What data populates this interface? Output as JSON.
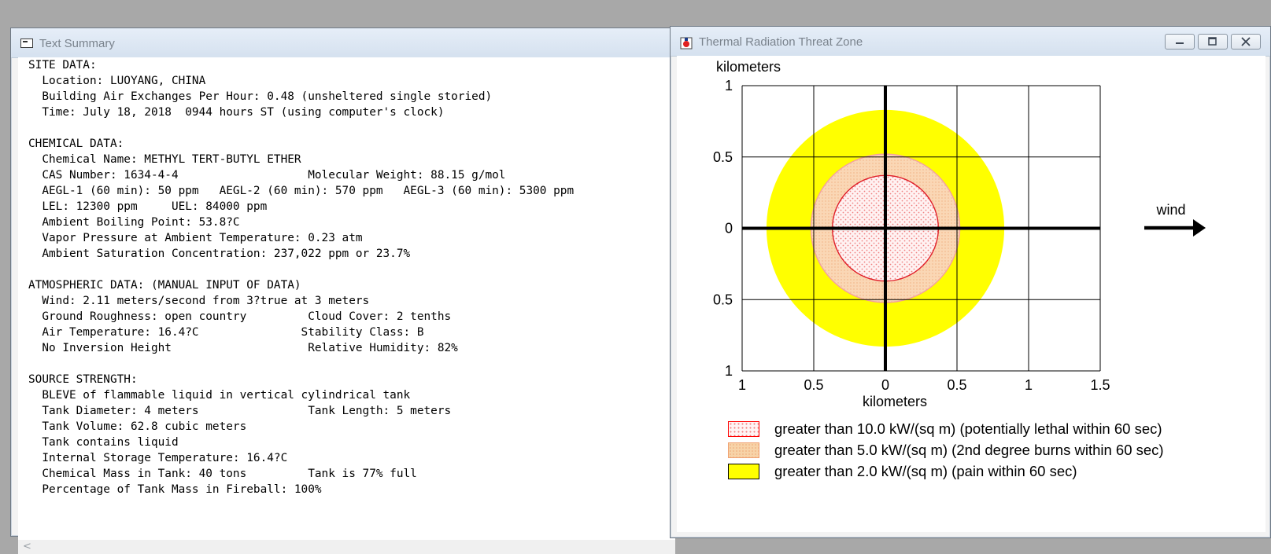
{
  "text_summary": {
    "title": "Text Summary",
    "lines": [
      "SITE DATA:",
      "  Location: LUOYANG, CHINA",
      "  Building Air Exchanges Per Hour: 0.48 (unsheltered single storied)",
      "  Time: July 18, 2018  0944 hours ST (using computer's clock)",
      "",
      "CHEMICAL DATA:",
      "  Chemical Name: METHYL TERT-BUTYL ETHER",
      "  CAS Number: 1634-4-4                   Molecular Weight: 88.15 g/mol",
      "  AEGL-1 (60 min): 50 ppm   AEGL-2 (60 min): 570 ppm   AEGL-3 (60 min): 5300 ppm",
      "  LEL: 12300 ppm     UEL: 84000 ppm",
      "  Ambient Boiling Point: 53.8?C",
      "  Vapor Pressure at Ambient Temperature: 0.23 atm",
      "  Ambient Saturation Concentration: 237,022 ppm or 23.7%",
      "",
      "ATMOSPHERIC DATA: (MANUAL INPUT OF DATA)",
      "  Wind: 2.11 meters/second from 3?true at 3 meters",
      "  Ground Roughness: open country         Cloud Cover: 2 tenths",
      "  Air Temperature: 16.4?C               Stability Class: B",
      "  No Inversion Height                    Relative Humidity: 82%",
      "",
      "SOURCE STRENGTH:",
      "  BLEVE of flammable liquid in vertical cylindrical tank",
      "  Tank Diameter: 4 meters                Tank Length: 5 meters",
      "  Tank Volume: 62.8 cubic meters",
      "  Tank contains liquid",
      "  Internal Storage Temperature: 16.4?C",
      "  Chemical Mass in Tank: 40 tons         Tank is 77% full",
      "  Percentage of Tank Mass in Fireball: 100%"
    ],
    "scroll_left_glyph": "<"
  },
  "threat_zone": {
    "title": "Thermal Radiation Threat Zone",
    "wind_label": "wind",
    "legend": [
      {
        "text": "greater than 10.0 kW/(sq m) (potentially lethal within 60 sec)",
        "color": "#ff0000"
      },
      {
        "text": "greater than 5.0 kW/(sq m) (2nd degree burns within 60 sec)",
        "color": "#f7d3a8"
      },
      {
        "text": "greater than 2.0 kW/(sq m) (pain within 60 sec)",
        "color": "#ffff00"
      }
    ]
  },
  "chart_data": {
    "type": "scatter",
    "title": "",
    "xlabel": "kilometers",
    "ylabel": "kilometers",
    "xlim": [
      -1,
      1.5
    ],
    "ylim": [
      -1,
      1
    ],
    "x_ticks": [
      -1,
      -0.5,
      0,
      0.5,
      1,
      1.5
    ],
    "x_tick_labels": [
      "1",
      "0.5",
      "0",
      "0.5",
      "1",
      "1.5"
    ],
    "y_ticks": [
      1,
      0.5,
      0,
      -0.5,
      -1
    ],
    "y_tick_labels": [
      "1",
      "0.5",
      "0",
      "0.5",
      "1"
    ],
    "grid": true,
    "zones": [
      {
        "name": "greater than 2.0 kW/(sq m) (pain within 60 sec)",
        "center": [
          0,
          0
        ],
        "radius_km": 0.83,
        "fill": "#ffff00",
        "stroke": "#000000"
      },
      {
        "name": "greater than 5.0 kW/(sq m) (2nd degree burns within 60 sec)",
        "center": [
          0,
          0
        ],
        "radius_km": 0.52,
        "fill": "#f7d3a8",
        "stroke": "#f4a0a0"
      },
      {
        "name": "greater than 10.0 kW/(sq m) (potentially lethal within 60 sec)",
        "center": [
          0,
          0
        ],
        "radius_km": 0.37,
        "fill": "#fde6e6",
        "stroke": "#e0202a"
      }
    ]
  }
}
